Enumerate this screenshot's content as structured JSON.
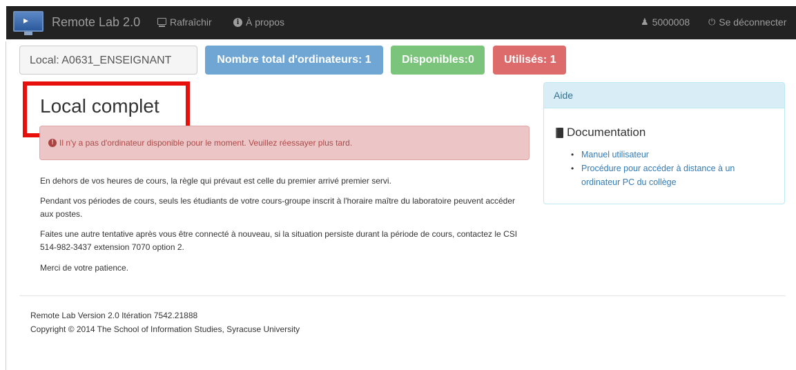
{
  "navbar": {
    "brand": "Remote Lab 2.0",
    "links": [
      {
        "label": "Rafraîchir",
        "icon": "monitor-icon"
      },
      {
        "label": "À propos",
        "icon": "info-icon"
      }
    ],
    "user": {
      "label": "5000008",
      "icon": "user-icon"
    },
    "logout": {
      "label": "Se déconnecter",
      "icon": "power-icon"
    }
  },
  "labels": {
    "local": "Local: A0631_ENSEIGNANT",
    "total": "Nombre total d'ordinateurs: 1",
    "available": "Disponibles:0",
    "used": "Utilisés: 1"
  },
  "main": {
    "title": "Local complet",
    "alert": "Il n'y a pas d'ordinateur disponible pour le moment. Veuillez réessayer plus tard.",
    "paragraphs": [
      "En dehors de vos heures de cours, la règle qui prévaut est celle du premier arrivé premier servi.",
      "Pendant vos périodes de cours, seuls les étudiants de votre cours-groupe inscrit à l'horaire maître du laboratoire peuvent accéder aux postes.",
      "Faites une autre tentative après vous être connecté à nouveau, si la situation persiste durant la période de cours, contactez le CSI 514-982-3437 extension 7070 option 2.",
      "Merci de votre patience."
    ]
  },
  "help_panel": {
    "heading": "Aide",
    "doc_title": "Documentation",
    "links": [
      "Manuel utilisateur",
      "Procédure pour accéder à distance à un ordinateur PC du collège"
    ]
  },
  "footer": {
    "version": "Remote Lab Version 2.0 Itération 7542.21888",
    "copyright": "Copyright © 2014 The School of Information Studies, Syracuse University"
  },
  "colors": {
    "navbar": "#222222",
    "primary_label": "#6fa6d3",
    "success_label": "#7bc47b",
    "danger_label": "#dd6b6b",
    "highlight": "#e8100c"
  }
}
